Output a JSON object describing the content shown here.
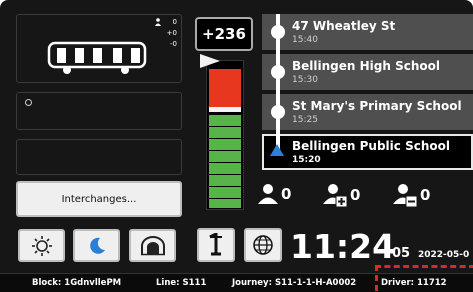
{
  "bus": {
    "counts": [
      "0",
      "+0",
      "-0"
    ],
    "icons": [
      "bus-icon",
      "person-icon"
    ]
  },
  "left_panel": {
    "interchanges_label": "Interchanges...",
    "mode_buttons": [
      "sun-icon",
      "moon-icon",
      "tunnel-icon"
    ]
  },
  "delay": {
    "value": "+236",
    "gauge_color_late": "#e7371f",
    "gauge_color_ontime": "#56b449"
  },
  "stops": [
    {
      "name": "47 Wheatley St",
      "time": "15:40",
      "current": false
    },
    {
      "name": "Bellingen High School",
      "time": "15:30",
      "current": false
    },
    {
      "name": "St Mary's Primary School",
      "time": "15:25",
      "current": false
    },
    {
      "name": "Bellingen Public School",
      "time": "15:20",
      "current": true
    }
  ],
  "passengers": {
    "onboard": "0",
    "boarding": "0",
    "alighting": "0"
  },
  "clock": {
    "time": "11:24",
    "seconds": "05",
    "date": "2022-05-0"
  },
  "status_bar": {
    "block": "Block: 1GdnvllePM",
    "line": "Line: S111",
    "journey": "Journey: S11-1-1-H-A0002",
    "driver": "Driver: 11712"
  },
  "colors": {
    "background": "#161616",
    "accent_blue": "#2b7fd6",
    "dashed_red": "#d92a2a"
  }
}
